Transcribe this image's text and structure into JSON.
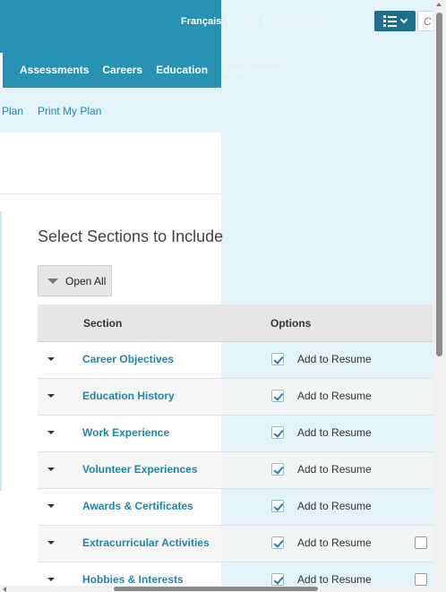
{
  "header": {
    "language_label": "Français",
    "separator": "|",
    "help_label": "Help",
    "my_account_label": "My Account",
    "menu_icon": "list-icon",
    "search_partial": "C"
  },
  "main_nav": {
    "items": [
      "Assessments",
      "Careers",
      "Education",
      "Employment"
    ]
  },
  "sub_nav": {
    "items": [
      "Plan",
      "Print My Plan"
    ]
  },
  "main": {
    "title": "Select Sections to Include",
    "open_all_label": "Open All"
  },
  "table": {
    "columns": [
      "Section",
      "Options"
    ],
    "rows": [
      {
        "section": "Career Objectives",
        "option": "Add to Resume",
        "checked": true,
        "extra_checkbox": false
      },
      {
        "section": "Education History",
        "option": "Add to Resume",
        "checked": true,
        "extra_checkbox": false
      },
      {
        "section": "Work Experience",
        "option": "Add to Resume",
        "checked": true,
        "extra_checkbox": false
      },
      {
        "section": "Volunteer Experiences",
        "option": "Add to Resume",
        "checked": true,
        "extra_checkbox": false
      },
      {
        "section": "Awards & Certificates",
        "option": "Add to Resume",
        "checked": true,
        "extra_checkbox": false
      },
      {
        "section": "Extracurricular Activities",
        "option": "Add to Resume",
        "checked": true,
        "extra_checkbox": true
      },
      {
        "section": "Hobbies & Interests",
        "option": "Add to Resume",
        "checked": true,
        "extra_checkbox": true
      }
    ]
  },
  "colors": {
    "header_blue": "#2892b5",
    "light_band": "#e2f3fa",
    "link_blue": "#1f86ab",
    "menu_button": "#1d6f8c"
  }
}
